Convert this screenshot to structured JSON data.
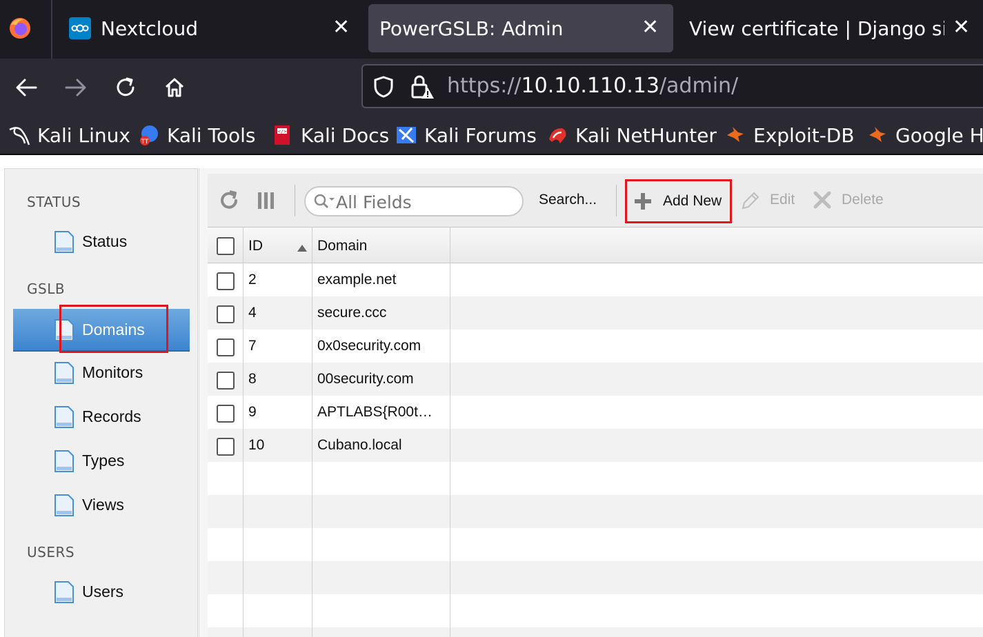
{
  "browser": {
    "tabs": [
      {
        "title": "Nextcloud",
        "active": false
      },
      {
        "title": "PowerGSLB: Admin",
        "active": true
      },
      {
        "title": "View certificate | Django site a",
        "active": false
      }
    ],
    "url_prefix": "https://",
    "url_host": "10.10.110.13",
    "url_path": "/admin/",
    "bookmarks": [
      {
        "label": "Kali Linux",
        "icon": "kali-dragon-icon"
      },
      {
        "label": "Kali Tools",
        "icon": "kali-tools-icon"
      },
      {
        "label": "Kali Docs",
        "icon": "kali-docs-icon"
      },
      {
        "label": "Kali Forums",
        "icon": "kali-forums-icon"
      },
      {
        "label": "Kali NetHunter",
        "icon": "kali-nethunter-icon"
      },
      {
        "label": "Exploit-DB",
        "icon": "exploit-db-icon"
      },
      {
        "label": "Google Ha",
        "icon": "google-hacking-icon"
      }
    ]
  },
  "sidebar": {
    "sections": [
      {
        "heading": "STATUS",
        "items": [
          "Status"
        ]
      },
      {
        "heading": "GSLB",
        "items": [
          "Domains",
          "Monitors",
          "Records",
          "Types",
          "Views"
        ]
      },
      {
        "heading": "USERS",
        "items": [
          "Users"
        ]
      }
    ],
    "active_item": "Domains"
  },
  "toolbar": {
    "search_placeholder": "All Fields",
    "search_label": "Search...",
    "add_label": "Add New",
    "edit_label": "Edit",
    "delete_label": "Delete"
  },
  "grid": {
    "columns": [
      "ID",
      "Domain"
    ],
    "sort_column": "ID",
    "sort_direction": "ascending",
    "rows": [
      {
        "id": "2",
        "domain": "example.net"
      },
      {
        "id": "4",
        "domain": "secure.ccc"
      },
      {
        "id": "7",
        "domain": "0x0security.com"
      },
      {
        "id": "8",
        "domain": "00security.com"
      },
      {
        "id": "9",
        "domain": "APTLABS{R00t…"
      },
      {
        "id": "10",
        "domain": "Cubano.local"
      }
    ]
  },
  "colors": {
    "highlight": "#e2141c",
    "active_item": "#4a8fd6"
  }
}
